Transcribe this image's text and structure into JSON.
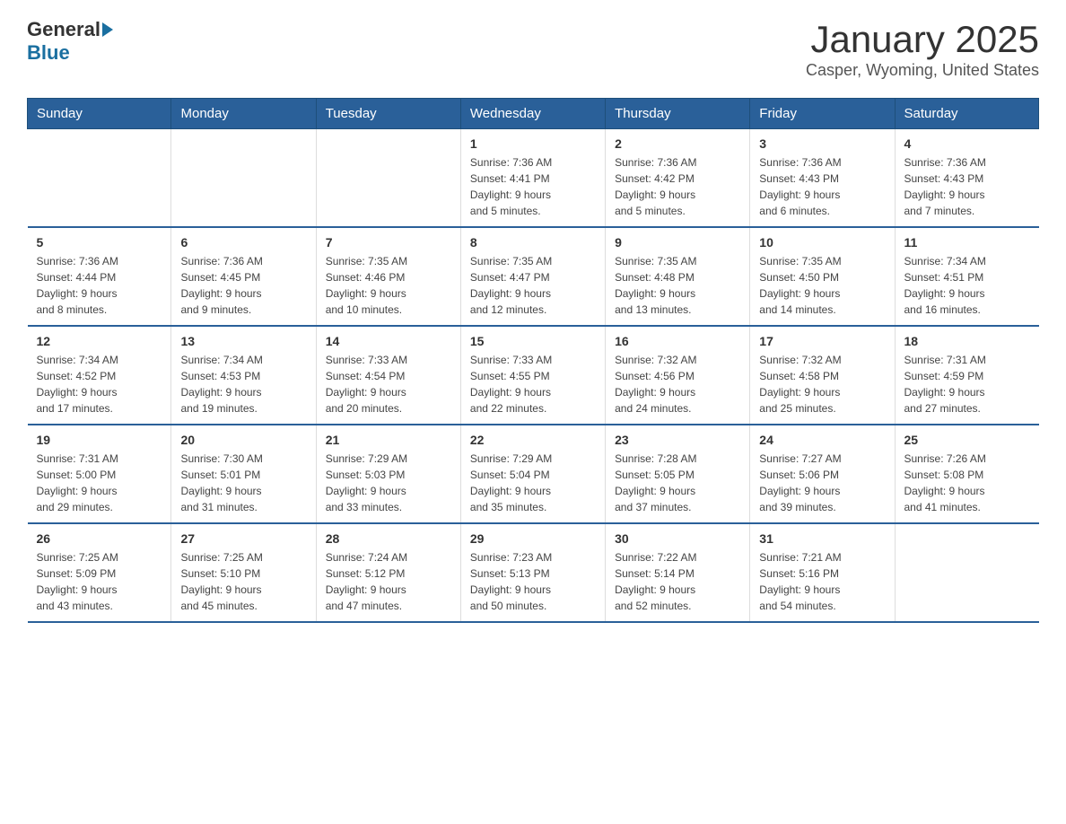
{
  "logo": {
    "text_general": "General",
    "text_blue": "Blue",
    "arrow": "▶"
  },
  "header": {
    "title": "January 2025",
    "subtitle": "Casper, Wyoming, United States"
  },
  "weekdays": [
    "Sunday",
    "Monday",
    "Tuesday",
    "Wednesday",
    "Thursday",
    "Friday",
    "Saturday"
  ],
  "weeks": [
    [
      {
        "day": "",
        "info": ""
      },
      {
        "day": "",
        "info": ""
      },
      {
        "day": "",
        "info": ""
      },
      {
        "day": "1",
        "info": "Sunrise: 7:36 AM\nSunset: 4:41 PM\nDaylight: 9 hours\nand 5 minutes."
      },
      {
        "day": "2",
        "info": "Sunrise: 7:36 AM\nSunset: 4:42 PM\nDaylight: 9 hours\nand 5 minutes."
      },
      {
        "day": "3",
        "info": "Sunrise: 7:36 AM\nSunset: 4:43 PM\nDaylight: 9 hours\nand 6 minutes."
      },
      {
        "day": "4",
        "info": "Sunrise: 7:36 AM\nSunset: 4:43 PM\nDaylight: 9 hours\nand 7 minutes."
      }
    ],
    [
      {
        "day": "5",
        "info": "Sunrise: 7:36 AM\nSunset: 4:44 PM\nDaylight: 9 hours\nand 8 minutes."
      },
      {
        "day": "6",
        "info": "Sunrise: 7:36 AM\nSunset: 4:45 PM\nDaylight: 9 hours\nand 9 minutes."
      },
      {
        "day": "7",
        "info": "Sunrise: 7:35 AM\nSunset: 4:46 PM\nDaylight: 9 hours\nand 10 minutes."
      },
      {
        "day": "8",
        "info": "Sunrise: 7:35 AM\nSunset: 4:47 PM\nDaylight: 9 hours\nand 12 minutes."
      },
      {
        "day": "9",
        "info": "Sunrise: 7:35 AM\nSunset: 4:48 PM\nDaylight: 9 hours\nand 13 minutes."
      },
      {
        "day": "10",
        "info": "Sunrise: 7:35 AM\nSunset: 4:50 PM\nDaylight: 9 hours\nand 14 minutes."
      },
      {
        "day": "11",
        "info": "Sunrise: 7:34 AM\nSunset: 4:51 PM\nDaylight: 9 hours\nand 16 minutes."
      }
    ],
    [
      {
        "day": "12",
        "info": "Sunrise: 7:34 AM\nSunset: 4:52 PM\nDaylight: 9 hours\nand 17 minutes."
      },
      {
        "day": "13",
        "info": "Sunrise: 7:34 AM\nSunset: 4:53 PM\nDaylight: 9 hours\nand 19 minutes."
      },
      {
        "day": "14",
        "info": "Sunrise: 7:33 AM\nSunset: 4:54 PM\nDaylight: 9 hours\nand 20 minutes."
      },
      {
        "day": "15",
        "info": "Sunrise: 7:33 AM\nSunset: 4:55 PM\nDaylight: 9 hours\nand 22 minutes."
      },
      {
        "day": "16",
        "info": "Sunrise: 7:32 AM\nSunset: 4:56 PM\nDaylight: 9 hours\nand 24 minutes."
      },
      {
        "day": "17",
        "info": "Sunrise: 7:32 AM\nSunset: 4:58 PM\nDaylight: 9 hours\nand 25 minutes."
      },
      {
        "day": "18",
        "info": "Sunrise: 7:31 AM\nSunset: 4:59 PM\nDaylight: 9 hours\nand 27 minutes."
      }
    ],
    [
      {
        "day": "19",
        "info": "Sunrise: 7:31 AM\nSunset: 5:00 PM\nDaylight: 9 hours\nand 29 minutes."
      },
      {
        "day": "20",
        "info": "Sunrise: 7:30 AM\nSunset: 5:01 PM\nDaylight: 9 hours\nand 31 minutes."
      },
      {
        "day": "21",
        "info": "Sunrise: 7:29 AM\nSunset: 5:03 PM\nDaylight: 9 hours\nand 33 minutes."
      },
      {
        "day": "22",
        "info": "Sunrise: 7:29 AM\nSunset: 5:04 PM\nDaylight: 9 hours\nand 35 minutes."
      },
      {
        "day": "23",
        "info": "Sunrise: 7:28 AM\nSunset: 5:05 PM\nDaylight: 9 hours\nand 37 minutes."
      },
      {
        "day": "24",
        "info": "Sunrise: 7:27 AM\nSunset: 5:06 PM\nDaylight: 9 hours\nand 39 minutes."
      },
      {
        "day": "25",
        "info": "Sunrise: 7:26 AM\nSunset: 5:08 PM\nDaylight: 9 hours\nand 41 minutes."
      }
    ],
    [
      {
        "day": "26",
        "info": "Sunrise: 7:25 AM\nSunset: 5:09 PM\nDaylight: 9 hours\nand 43 minutes."
      },
      {
        "day": "27",
        "info": "Sunrise: 7:25 AM\nSunset: 5:10 PM\nDaylight: 9 hours\nand 45 minutes."
      },
      {
        "day": "28",
        "info": "Sunrise: 7:24 AM\nSunset: 5:12 PM\nDaylight: 9 hours\nand 47 minutes."
      },
      {
        "day": "29",
        "info": "Sunrise: 7:23 AM\nSunset: 5:13 PM\nDaylight: 9 hours\nand 50 minutes."
      },
      {
        "day": "30",
        "info": "Sunrise: 7:22 AM\nSunset: 5:14 PM\nDaylight: 9 hours\nand 52 minutes."
      },
      {
        "day": "31",
        "info": "Sunrise: 7:21 AM\nSunset: 5:16 PM\nDaylight: 9 hours\nand 54 minutes."
      },
      {
        "day": "",
        "info": ""
      }
    ]
  ]
}
